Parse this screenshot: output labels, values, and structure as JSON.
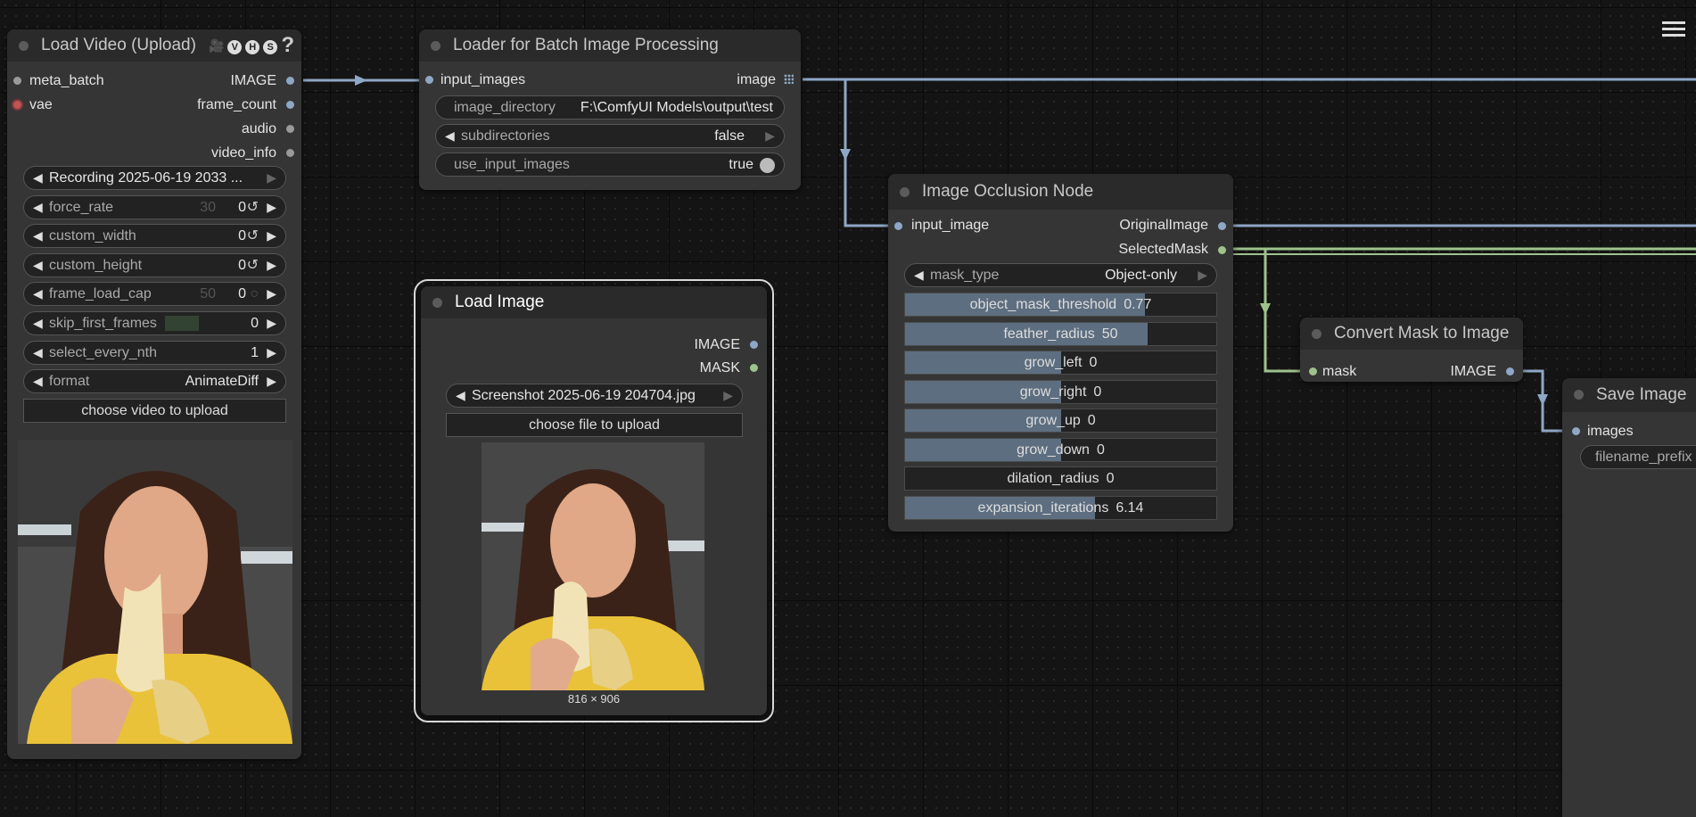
{
  "load_video": {
    "title": "Load Video (Upload)",
    "badges": [
      "🎥",
      "V",
      "H",
      "S"
    ],
    "help": "?",
    "inputs": [
      "meta_batch",
      "vae"
    ],
    "outputs": [
      "IMAGE",
      "frame_count",
      "audio",
      "video_info"
    ],
    "video_file": "Recording 2025-06-19 2033 ...",
    "force_rate": {
      "label": "force_rate",
      "hint": "30",
      "value": "0"
    },
    "custom_width": {
      "label": "custom_width",
      "value": "0"
    },
    "custom_height": {
      "label": "custom_height",
      "value": "0"
    },
    "frame_load_cap": {
      "label": "frame_load_cap",
      "hint": "50",
      "value": "0"
    },
    "skip_first_frames": {
      "label": "skip_first_frames",
      "value": "0"
    },
    "select_every_nth": {
      "label": "select_every_nth",
      "value": "1"
    },
    "format": {
      "label": "format",
      "value": "AnimateDiff"
    },
    "upload_button": "choose video to upload"
  },
  "batch_loader": {
    "title": "Loader for Batch Image Processing",
    "input": "input_images",
    "output": "image",
    "image_directory": {
      "label": "image_directory",
      "value": "F:\\ComfyUI Models\\output\\test"
    },
    "subdirectories": {
      "label": "subdirectories",
      "value": "false"
    },
    "use_input_images": {
      "label": "use_input_images",
      "value": "true"
    }
  },
  "load_image": {
    "title": "Load Image",
    "outputs": [
      "IMAGE",
      "MASK"
    ],
    "file": "Screenshot 2025-06-19 204704.jpg",
    "upload_button": "choose file to upload",
    "dimensions": "816 × 906"
  },
  "occlusion": {
    "title": "Image Occlusion Node",
    "input": "input_image",
    "outputs": [
      "OriginalImage",
      "SelectedMask"
    ],
    "mask_type": {
      "label": "mask_type",
      "value": "Object-only"
    },
    "sliders": [
      {
        "label": "object_mask_threshold",
        "value": "0.77",
        "fill": 0.77
      },
      {
        "label": "feather_radius",
        "value": "50",
        "fill": 0.78
      },
      {
        "label": "grow_left",
        "value": "0",
        "fill": 0.5
      },
      {
        "label": "grow_right",
        "value": "0",
        "fill": 0.5
      },
      {
        "label": "grow_up",
        "value": "0",
        "fill": 0.5
      },
      {
        "label": "grow_down",
        "value": "0",
        "fill": 0.5
      },
      {
        "label": "dilation_radius",
        "value": "0",
        "fill": 0
      },
      {
        "label": "expansion_iterations",
        "value": "6.14",
        "fill": 0.61
      }
    ]
  },
  "convert_mask": {
    "title": "Convert Mask to Image",
    "input": "mask",
    "output": "IMAGE"
  },
  "save_image": {
    "title": "Save Image",
    "input": "images",
    "filename_prefix": "filename_prefix"
  },
  "colors": {
    "image_wire": "#8fa7c6",
    "mask_wire": "#9ec28c",
    "node_bg": "#353535",
    "title_bg": "#2a2a2a"
  }
}
